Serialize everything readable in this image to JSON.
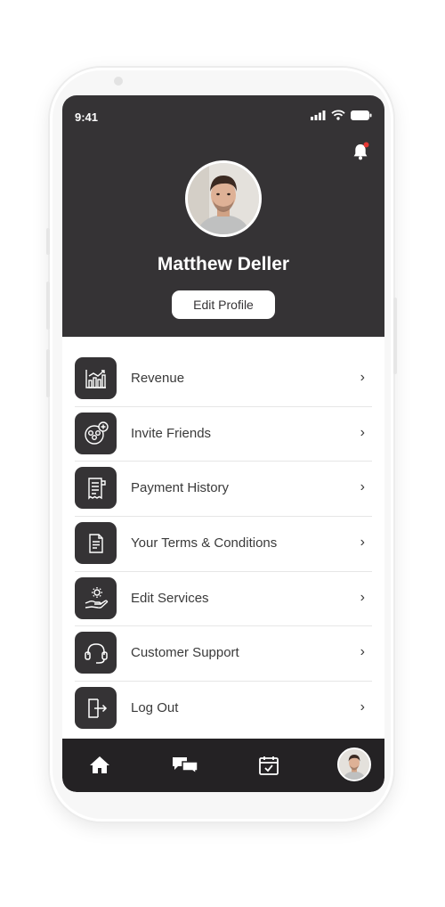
{
  "status_bar": {
    "time": "9:41"
  },
  "profile": {
    "name": "Matthew Deller",
    "edit_label": "Edit Profile"
  },
  "menu": {
    "items": [
      {
        "label": "Revenue",
        "icon": "revenue-chart-icon"
      },
      {
        "label": "Invite Friends",
        "icon": "invite-friends-icon"
      },
      {
        "label": "Payment History",
        "icon": "receipt-icon"
      },
      {
        "label": "Your Terms & Conditions",
        "icon": "document-icon"
      },
      {
        "label": "Edit Services",
        "icon": "service-gear-hand-icon"
      },
      {
        "label": "Customer Support",
        "icon": "headset-icon"
      },
      {
        "label": "Log Out",
        "icon": "logout-icon"
      }
    ],
    "chevron": "›"
  },
  "tabbar": {
    "tabs": [
      "home-icon",
      "chat-icon",
      "calendar-check-icon",
      "profile-avatar"
    ]
  },
  "colors": {
    "header_bg": "#353335",
    "tabbar_bg": "#242224",
    "notification_dot": "#e53935",
    "icon_tile_bg": "#353335"
  }
}
